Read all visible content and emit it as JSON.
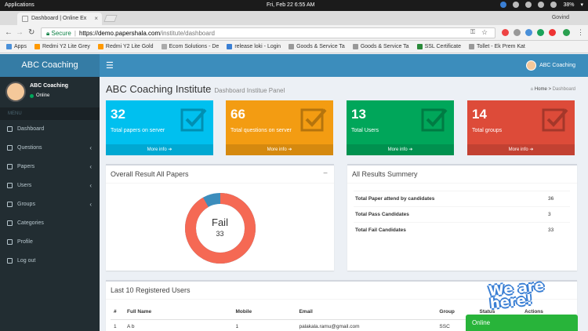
{
  "os": {
    "apps_label": "Applications",
    "clock": "Fri, Feb 22   6:55 AM",
    "battery": "38%"
  },
  "browser": {
    "tab_title": "Dashboard | Online Ex",
    "profile_name": "Govind",
    "url_secure": "Secure",
    "url_host": "https://demo.papershala.com",
    "url_path": "/institute/dashboard",
    "bookmarks": [
      "Apps",
      "Redmi Y2 Lite Grey",
      "Redmi Y2 Lite Gold",
      "Ecom Solutions - De",
      "release loki - Login",
      "Goods & Service Ta",
      "Goods & Service Ta",
      "SSL Certificate",
      "Tollet - Ek Prem Kat"
    ]
  },
  "app": {
    "logo": "ABC Coaching",
    "header_user": "ABC Coaching",
    "sidebar": {
      "user_name": "ABC Coaching",
      "user_status": "Online",
      "menu_header": "MENU",
      "items": [
        {
          "label": "Dashboard",
          "has_children": false
        },
        {
          "label": "Questions",
          "has_children": true
        },
        {
          "label": "Papers",
          "has_children": true
        },
        {
          "label": "Users",
          "has_children": true
        },
        {
          "label": "Groups",
          "has_children": true
        },
        {
          "label": "Categories",
          "has_children": false
        },
        {
          "label": "Profile",
          "has_children": false
        },
        {
          "label": "Log out",
          "has_children": false
        }
      ]
    },
    "page": {
      "title": "ABC Coaching Institute",
      "subtitle": "Dashboard Institue Panel",
      "breadcrumb_home": "Home",
      "breadcrumb_current": "Dashboard"
    },
    "stat_boxes": [
      {
        "number": "32",
        "label": "Total papers on server",
        "more": "More info",
        "color": "#00c0ef",
        "icon": "checkbox-icon"
      },
      {
        "number": "66",
        "label": "Total questions on server",
        "more": "More info",
        "color": "#f39c12",
        "icon": "book-icon"
      },
      {
        "number": "13",
        "label": "Total Users",
        "more": "More info",
        "color": "#00a65a",
        "icon": "users-icon"
      },
      {
        "number": "14",
        "label": "Total groups",
        "more": "More info",
        "color": "#dd4b39",
        "icon": "shuffle-icon"
      }
    ],
    "result_panel": {
      "title": "Overall Result All Papers",
      "center_label": "Fail",
      "center_value": "33",
      "fail_fraction": 0.917,
      "fail_color": "#f56954",
      "pass_color": "#3c8dbc"
    },
    "summary_panel": {
      "title": "All Results Summery",
      "rows": [
        {
          "label": "Total Paper attend by candidates",
          "value": "36"
        },
        {
          "label": "Total Pass Candidates",
          "value": "3"
        },
        {
          "label": "Total Fail Candidates",
          "value": "33"
        }
      ]
    },
    "users_panel": {
      "title": "Last 10 Registered Users",
      "columns": [
        "#",
        "Full Name",
        "Mobile",
        "Email",
        "Group",
        "Status",
        "Actions"
      ],
      "rows": [
        {
          "num": "1",
          "name": "A b",
          "mobile": "1",
          "email": "palakala.ramu@gmail.com",
          "group": "SSC",
          "status": ""
        }
      ]
    },
    "chat": {
      "banner": "We are here!",
      "status": "Online"
    }
  }
}
